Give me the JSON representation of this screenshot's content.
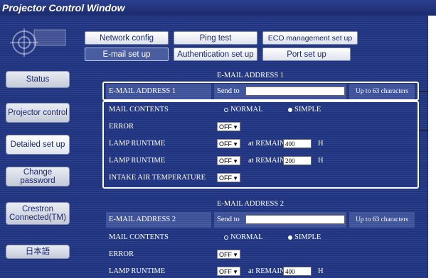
{
  "window": {
    "title": "Projector Control Window"
  },
  "sidebar": {
    "items": [
      {
        "label": "Status"
      },
      {
        "label": "Projector control"
      },
      {
        "label": "Detailed set up"
      },
      {
        "label": "Change password"
      },
      {
        "label": "Crestron Connected(TM)"
      },
      {
        "label": "日本語"
      }
    ]
  },
  "tabs": {
    "row1": [
      {
        "label": "Network config"
      },
      {
        "label": "Ping test"
      },
      {
        "label": "ECO management set up"
      }
    ],
    "row2": [
      {
        "label": "E-mail set up"
      },
      {
        "label": "Authentication set up"
      },
      {
        "label": "Port set up"
      }
    ]
  },
  "email1": {
    "section_title": "E-MAIL ADDRESS 1",
    "address_label": "E-MAIL ADDRESS 1",
    "send_to_label": "Send to",
    "send_to_value": "",
    "limit_note": "Up to 63 characters",
    "mail_contents_label": "MAIL CONTENTS",
    "normal_label": "NORMAL",
    "simple_label": "SIMPLE",
    "error_label": "ERROR",
    "error_value": "OFF",
    "lamp1_label": "LAMP RUNTIME",
    "lamp1_value": "OFF",
    "lamp1_remain_label": "at REMAIN",
    "lamp1_remain_value": "400",
    "lamp1_unit": "H",
    "lamp2_label": "LAMP RUNTIME",
    "lamp2_value": "OFF",
    "lamp2_remain_label": "at REMAIN",
    "lamp2_remain_value": "200",
    "lamp2_unit": "H",
    "intake_label": "INTAKE AIR TEMPERATURE",
    "intake_value": "OFF"
  },
  "email2": {
    "section_title": "E-MAIL ADDRESS 2",
    "address_label": "E-MAIL ADDRESS 2",
    "send_to_label": "Send to",
    "send_to_value": "",
    "limit_note": "Up to 63 characters",
    "mail_contents_label": "MAIL CONTENTS",
    "normal_label": "NORMAL",
    "simple_label": "SIMPLE",
    "error_label": "ERROR",
    "error_value": "OFF",
    "lamp1_label": "LAMP RUNTIME",
    "lamp1_value": "OFF",
    "lamp1_remain_label": "at REMAIN",
    "lamp1_remain_value": "400",
    "lamp1_unit": "H"
  },
  "colors": {
    "background": "#1f3480",
    "titlebar": "#1c2b6e",
    "tab_active": "#4a5da0"
  }
}
